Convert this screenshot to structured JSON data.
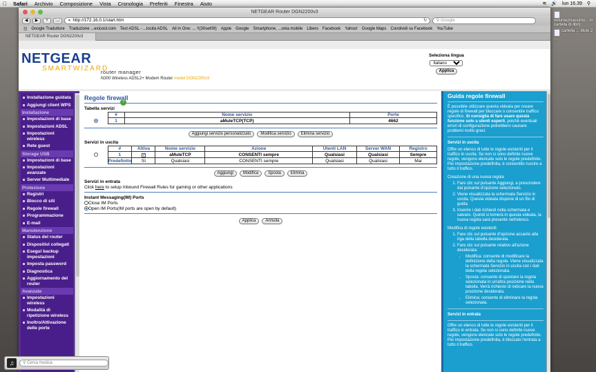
{
  "menubar": {
    "apple": "",
    "app": "Safari",
    "items": [
      "Archivio",
      "Composizione",
      "Vista",
      "Cronologia",
      "Preferiti",
      "Finestra",
      "Aiuto"
    ],
    "clock": "lun 16.39"
  },
  "desktop": {
    "icons": [
      "volume(massimo... in cartella di libri)",
      "cartella ... titolo 2 ...",
      "cartella ... titolo 2 ... cartella"
    ]
  },
  "browser": {
    "window_title": "NETGEAR Router DGN2200v3",
    "url": "http://172.16.0.1/start.htm",
    "search_placeholder": "Google",
    "bookmarks": [
      "Google Traduttore",
      "Traduzione ...exicool.com",
      "Test ADSL - ...locità ADSL",
      "All in One: ... !!(30set09)",
      "Apple",
      "Google",
      "Smartphone, ...onia mobile",
      "Libero",
      "Facebook",
      "Yahoo!",
      "Google Maps",
      "Condividi su Facebook",
      "YouTube"
    ],
    "tab_label": "NETGEAR Router DGN2200v3"
  },
  "header": {
    "logo_top": "NETGEAR",
    "logo_bottom": "SMARTWIZARD",
    "router_manager": "router manager",
    "model_desc": "N300 Wireless ADSL2+ Modem Router",
    "model_name": "model DGN2200v3",
    "lang_label": "Seleziona lingua",
    "lang_value": "Italiano",
    "apply_label": "Applica"
  },
  "sidebar": {
    "top": [
      "Installazione guidata",
      "Aggiungi client WPS"
    ],
    "sections": [
      {
        "title": "Installazione",
        "items": [
          "Impostazioni di base",
          "Impostazioni ADSL",
          "Impostazioni wireless",
          "Rete guest"
        ]
      },
      {
        "title": "Storage USB",
        "items": [
          "Impostazioni di base",
          "Impostazioni avanzate",
          "Server Multimediale"
        ]
      },
      {
        "title": "Protezione",
        "items": [
          "Registri",
          "Blocco di siti",
          "Regole firewall",
          "Programmazione",
          "E-mail"
        ]
      },
      {
        "title": "Manutenzione",
        "items": [
          "Status del router",
          "Dispositivi collegati",
          "Esegui backup impostazioni",
          "Imposta password",
          "Diagnostica",
          "Aggiornamento del router"
        ]
      },
      {
        "title": "Avanzate",
        "items": [
          "Impostazioni wireless",
          "Modalità di ripetizione wireless",
          "Inoltro/Attivazione delle porte"
        ]
      }
    ]
  },
  "main": {
    "title": "Regole firewall",
    "services_table": {
      "heading": "Tabella servizi",
      "columns": [
        "#",
        "Nome servizio",
        "Porte"
      ],
      "rows": [
        {
          "num": "1",
          "name": "aMuleTCP(TCP)",
          "ports": "4662"
        }
      ]
    },
    "service_buttons": [
      "Aggiungi servizio personalizzato",
      "Modifica servizio",
      "Elimina servizio"
    ],
    "outbound": {
      "heading": "Servizi in uscita",
      "columns": [
        "#",
        "Attiva",
        "Nome servizio",
        "Azione",
        "Utenti LAN",
        "Server WAN",
        "Registro"
      ],
      "rows": [
        {
          "num": "1",
          "active": "✓",
          "name": "aMuleTCP",
          "action": "CONSENTI sempre",
          "lan": "Qualsiasi",
          "wan": "Qualsiasi",
          "log": "Sempre"
        },
        {
          "num": "Predefinito",
          "active": "Sì",
          "name": "Qualsiasi",
          "action": "CONSENTI sempre",
          "lan": "Qualsiasi",
          "wan": "Qualsiasi",
          "log": "Mai"
        }
      ]
    },
    "outbound_buttons": [
      "Aggiungi",
      "Modifica",
      "Sposta",
      "Elimina"
    ],
    "inbound_heading": "Servizi in entrata",
    "inbound_pre": "Click ",
    "inbound_link": "here",
    "inbound_post": " to setup Inbound Firewall Rules for gaming or other applications",
    "im_heading": "Instant Messaging(IM) Ports",
    "im_close": "Close IM Ports",
    "im_open": "Open IM Ports(IM ports are open by default)",
    "apply": "Applica",
    "cancel": "Annulla"
  },
  "help": {
    "title": "Guida regole firewall",
    "intro_a": "È possibile utilizzare questa videata per creare regole di firewall per bloccare o consentire traffico specifico. ",
    "intro_b": "Si consiglia di fare usare questa funzione solo a utenti esperti",
    "intro_c": ", poiché eventuali errori di configurazione potrebbero causare problemi molto gravi.",
    "out_h": "Servizi in uscita",
    "out_p": "Offre un elenco di tutte le regole esistenti per il traffico in uscita. Se non si sono definite nuove regole, vengono elencate solo le regole predefinite. Per impostazione predefinita, è consentito ruscire a tutto il traffico.",
    "create_h": "Creazione di una nuova regola",
    "create_steps": [
      "Fare clic sul pulsante Aggiungi, a prescindere dal pulsante d'opzione selezionato.",
      "Viene visualizzata la schermata Servizio in uscita. Questa videata dispone di un filo di guida.",
      "Inserire i dati richiesti nella schermata e salvare. Quindi si tornerà in questa videata, la nuova regola sarà presente nell'elenco."
    ],
    "edit_h": "Modifica di regole esistenti",
    "edit_steps": [
      "Fare clic sul pulsante d'opzione accanto alla riga della tabella desiderata.",
      "Fare clic sul pulsante relativo all'azione desiderata:"
    ],
    "edit_bullets": [
      "Modifica: consente di modificare la definizione della regola. Viene visualizzata la schermata Servizio in uscita con i dati della regola selezionata.",
      "Sposta: consente di spostare la regola selezionata in un'altra posizione nella tabella. Verrà richiesto di indicare la nuova posizione desiderata.",
      "Elimina: consente di eliminare la regola selezionata."
    ],
    "in_h": "Servizi in entrata",
    "in_p": "Offre un elenco di tutte le regole esistenti per il traffico in entrata. Se non si sono definite nuove regole, vengono elencate solo le regole predefinite. Per impostazione predefinita, è bloccato l'entrata a tutto il traffico."
  },
  "dock": {
    "search_placeholder": "Cerca musica"
  }
}
